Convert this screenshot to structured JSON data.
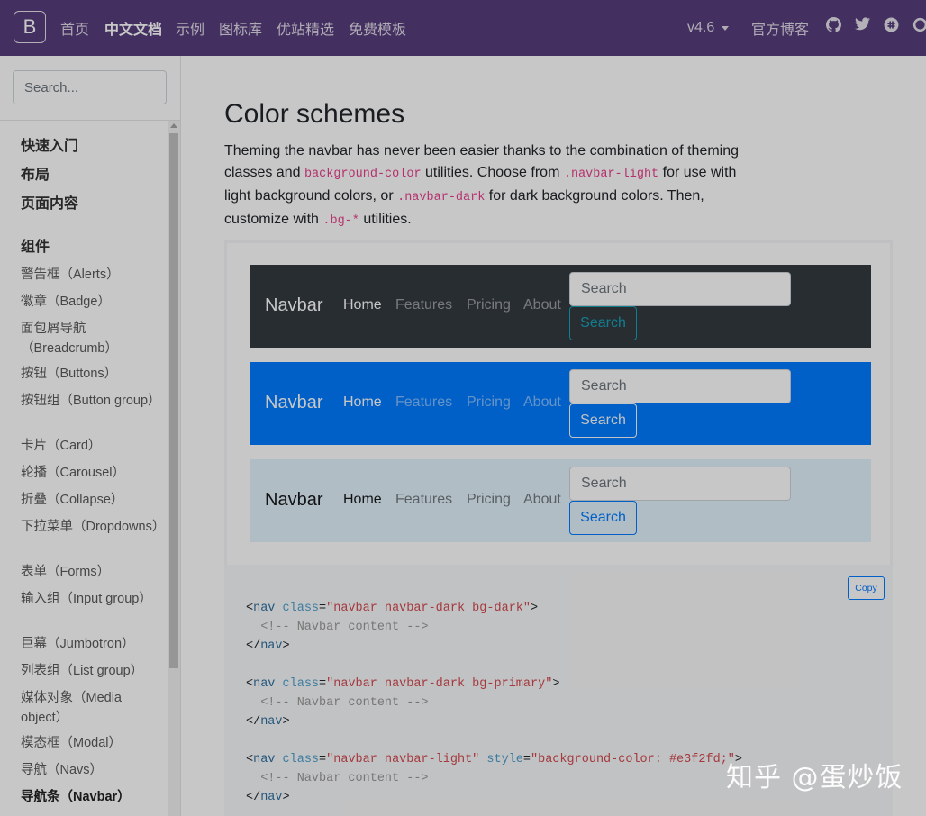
{
  "topnav": {
    "brand": "B",
    "links": [
      "首页",
      "中文文档",
      "示例",
      "图标库",
      "优站精选",
      "免费模板"
    ],
    "active_index": 1,
    "version": "v4.6",
    "blog": "官方博客",
    "icons": [
      "github-icon",
      "twitter-icon",
      "slack-icon",
      "opencollective-icon"
    ]
  },
  "sidebar": {
    "search_placeholder": "Search...",
    "items": [
      {
        "label": "快速入门",
        "kind": "hdr"
      },
      {
        "label": "布局",
        "kind": "hdr"
      },
      {
        "label": "页面内容",
        "kind": "hdr"
      },
      {
        "label": "组件",
        "kind": "hdr"
      },
      {
        "label": "警告框（Alerts）",
        "kind": "item"
      },
      {
        "label": "徽章（Badge）",
        "kind": "item"
      },
      {
        "label": "面包屑导航（Breadcrumb）",
        "kind": "item"
      },
      {
        "label": "按钮（Buttons）",
        "kind": "item"
      },
      {
        "label": "按钮组（Button group）",
        "kind": "item"
      },
      {
        "label": "卡片（Card）",
        "kind": "item"
      },
      {
        "label": "轮播（Carousel）",
        "kind": "item"
      },
      {
        "label": "折叠（Collapse）",
        "kind": "item"
      },
      {
        "label": "下拉菜单（Dropdowns）",
        "kind": "item"
      },
      {
        "label": "表单（Forms）",
        "kind": "item"
      },
      {
        "label": "输入组（Input group）",
        "kind": "item"
      },
      {
        "label": "巨幕（Jumbotron）",
        "kind": "item"
      },
      {
        "label": "列表组（List group）",
        "kind": "item"
      },
      {
        "label": "媒体对象（Media object）",
        "kind": "item"
      },
      {
        "label": "模态框（Modal）",
        "kind": "item"
      },
      {
        "label": "导航（Navs）",
        "kind": "item"
      },
      {
        "label": "导航条（Navbar）",
        "kind": "cur"
      }
    ]
  },
  "main": {
    "title": "Color schemes",
    "para": {
      "p1": "Theming the navbar has never been easier thanks to the combination of theming classes and ",
      "c1": "background-color",
      "p2": " utilities. Choose from ",
      "c2": ".navbar-light",
      "p3": " for use with light background colors, or ",
      "c3": ".navbar-dark",
      "p4": " for dark background colors. Then, customize with ",
      "c4": ".bg-*",
      "p5": " utilities."
    },
    "navbars": [
      {
        "variant": "dark",
        "brand": "Navbar",
        "links": [
          "Home",
          "Features",
          "Pricing",
          "About"
        ],
        "search_placeholder": "Search",
        "button": "Search"
      },
      {
        "variant": "primary",
        "brand": "Navbar",
        "links": [
          "Home",
          "Features",
          "Pricing",
          "About"
        ],
        "search_placeholder": "Search",
        "button": "Search"
      },
      {
        "variant": "light",
        "brand": "Navbar",
        "links": [
          "Home",
          "Features",
          "Pricing",
          "About"
        ],
        "search_placeholder": "Search",
        "button": "Search"
      }
    ],
    "copy_label": "Copy",
    "code_blocks": [
      {
        "open_tag": "nav",
        "attr": "class",
        "value": "\"navbar navbar-dark bg-dark\"",
        "comment": "<!-- Navbar content -->"
      },
      {
        "open_tag": "nav",
        "attr": "class",
        "value": "\"navbar navbar-dark bg-primary\"",
        "comment": "<!-- Navbar content -->"
      },
      {
        "open_tag": "nav",
        "attr": "class",
        "value": "\"navbar navbar-light\"",
        "attr2": "style",
        "value2": "\"background-color: #e3f2fd;\"",
        "comment": "<!-- Navbar content -->"
      }
    ]
  },
  "watermark": "知乎 @蛋炒饭",
  "colors": {
    "brand_purple": "#563d7c",
    "primary": "#007bff",
    "dark": "#343a40",
    "light_bg": "#e3f2fd",
    "info": "#17a2b8",
    "code_pink": "#e83e8c"
  }
}
